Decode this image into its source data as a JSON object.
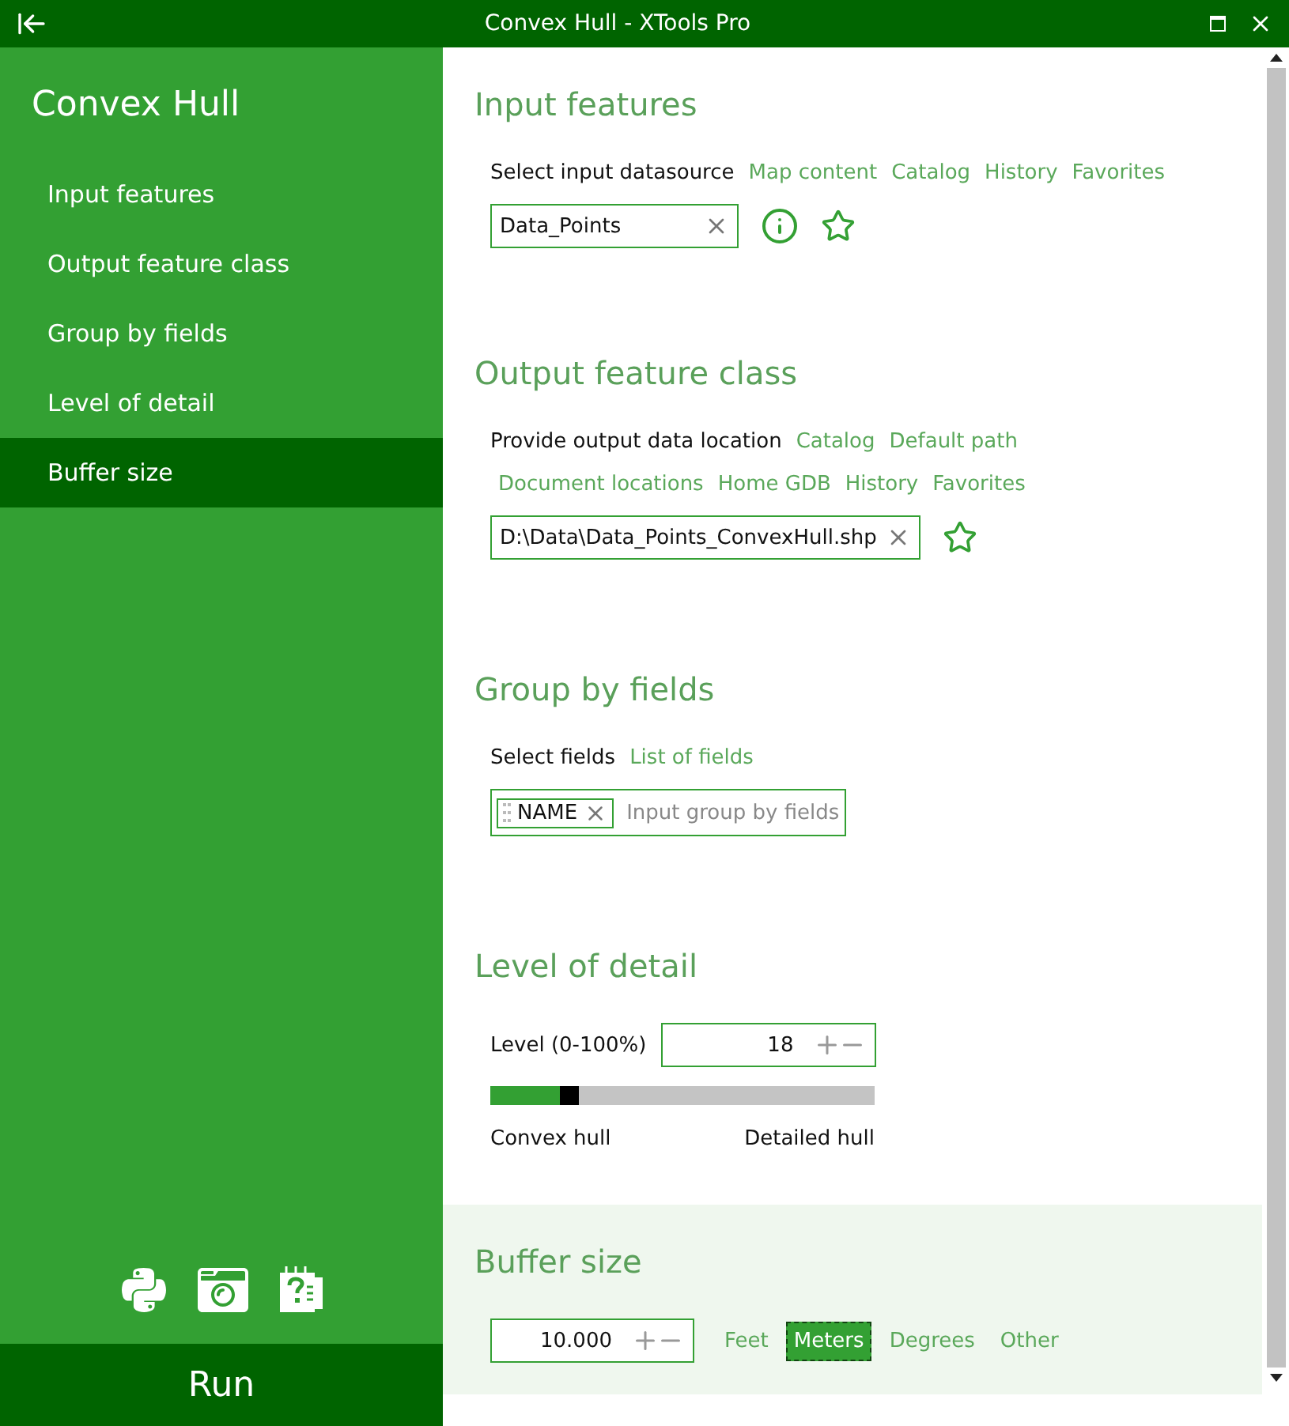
{
  "window": {
    "title": "Convex Hull - XTools Pro"
  },
  "sidebar": {
    "title": "Convex Hull",
    "items": [
      {
        "label": "Input features",
        "selected": false
      },
      {
        "label": "Output feature class",
        "selected": false
      },
      {
        "label": "Group by fields",
        "selected": false
      },
      {
        "label": "Level of detail",
        "selected": false
      },
      {
        "label": "Buffer size",
        "selected": true
      }
    ],
    "run_button": "Run"
  },
  "sections": [
    {
      "kind": "datasource",
      "heading": "Input features",
      "highlighted": false,
      "prompt": "Select input datasource",
      "links": [
        "Map content",
        "Catalog",
        "History",
        "Favorites"
      ],
      "value": "Data_Points"
    },
    {
      "kind": "output",
      "heading": "Output feature class",
      "highlighted": false,
      "prompt": "Provide output data location",
      "links": [
        "Catalog",
        "Default path"
      ],
      "links_2": [
        "Document locations",
        "Home GDB",
        "History",
        "Favorites"
      ],
      "value": "D:\\Data\\Data_Points_ConvexHull.shp"
    },
    {
      "kind": "fields",
      "heading": "Group by fields",
      "highlighted": false,
      "prompt": "Select fields",
      "links": [
        "List of fields"
      ],
      "tags": [
        "NAME"
      ],
      "placeholder": "Input group by fields"
    },
    {
      "kind": "level",
      "heading": "Level of detail",
      "highlighted": false,
      "label": "Level (0-100%)",
      "value": "18",
      "level": 0.18,
      "min_label": "Convex hull",
      "max_label": "Detailed hull"
    },
    {
      "kind": "buffer",
      "heading": "Buffer size",
      "highlighted": true,
      "value": "10.000",
      "units": [
        {
          "label": "Feet",
          "selected": false
        },
        {
          "label": "Meters",
          "selected": true
        },
        {
          "label": "Degrees",
          "selected": false
        },
        {
          "label": "Other",
          "selected": false
        }
      ]
    }
  ]
}
